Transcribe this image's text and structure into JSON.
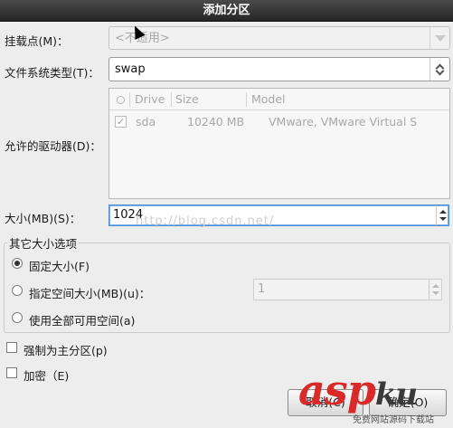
{
  "window": {
    "title": "添加分区"
  },
  "mount_point": {
    "label": "挂载点(M)：",
    "value": "<不适用>"
  },
  "fs_type": {
    "label": "文件系统类型(T)：",
    "value": "swap"
  },
  "drives": {
    "label": "允许的驱动器(D)：",
    "columns": [
      "Drive",
      "Size",
      "Model"
    ],
    "rows": [
      {
        "checked": true,
        "drive": "sda",
        "size": "10240 MB",
        "model": "VMware, VMware Virtual S"
      }
    ]
  },
  "size": {
    "label": "大小(MB)(S)：",
    "value": "1024"
  },
  "other_options": {
    "title": "其它大小选项",
    "fixed": {
      "label": "固定大小(F)",
      "selected": true
    },
    "up_to": {
      "label": "指定空间大小(MB)(u)：",
      "value": "1"
    },
    "fill": {
      "label": "使用全部可用空间(a)"
    }
  },
  "force_primary": {
    "label": "强制为主分区(p)"
  },
  "encrypt": {
    "label": "加密（E)"
  },
  "buttons": {
    "cancel": "取消(C)",
    "ok": "确定(O)"
  },
  "watermark_text": "http://blog.csdn.net/",
  "brand": {
    "asp": "asp",
    "ku": "ku",
    "sub": "免费网站源码下载站"
  },
  "icons": {
    "dropdown": "triangle-down-icon",
    "spinner": "updown-icon",
    "cursor": "mouse-cursor-icon"
  }
}
